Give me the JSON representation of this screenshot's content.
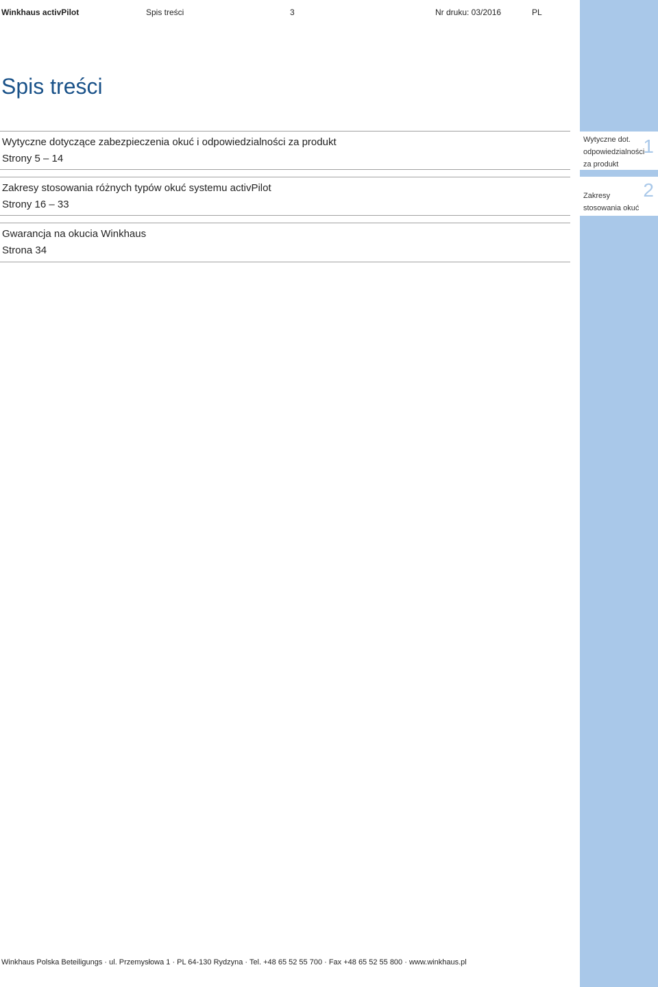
{
  "header": {
    "brand": "Winkhaus activPilot",
    "section": "Spis treści",
    "page_number": "3",
    "print_number": "Nr druku: 03/2016",
    "language": "PL"
  },
  "title": "Spis treści",
  "toc": [
    {
      "title": "Wytyczne dotyczące zabezpieczenia okuć i odpowiedzialności za produkt",
      "pages": "Strony 5 – 14"
    },
    {
      "title": "Zakresy stosowania różnych typów okuć systemu activPilot",
      "pages": "Strony 16 – 33"
    },
    {
      "title": "Gwarancja na okucia Winkhaus",
      "pages": "Strona 34"
    }
  ],
  "side_tabs": [
    {
      "lines": [
        "Wytyczne dot.",
        "odpowiedzialności",
        "za produkt"
      ],
      "number": "1"
    },
    {
      "lines": [
        "Zakresy",
        "stosowania okuć"
      ],
      "number": "2"
    }
  ],
  "colors": {
    "accent": "#1a5289",
    "sideband": "#a9c8e9",
    "rule": "#a0a0a0"
  },
  "footer": "Winkhaus Polska Beteiligungs · ul. Przemysłowa 1 · PL 64-130 Rydzyna · Tel. +48 65 52 55 700 · Fax +48 65 52 55 800 · www.winkhaus.pl"
}
